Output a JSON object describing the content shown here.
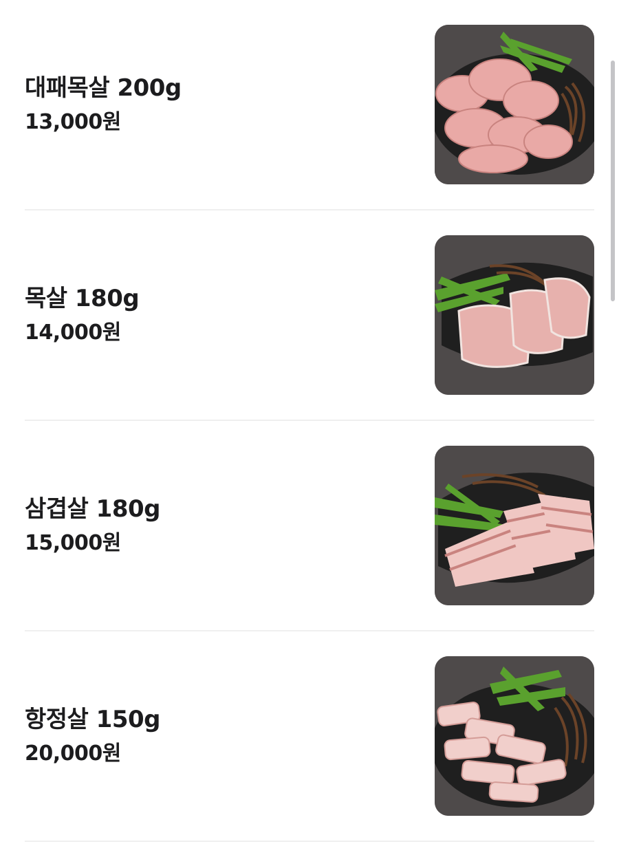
{
  "menu": {
    "items": [
      {
        "name": "대패목살 200g",
        "price": "13,000원",
        "image": "sliced-pork-neck-plate"
      },
      {
        "name": "목살 180g",
        "price": "14,000원",
        "image": "pork-neck-plate"
      },
      {
        "name": "삼겹살 180g",
        "price": "15,000원",
        "image": "pork-belly-plate"
      },
      {
        "name": "항정살 150g",
        "price": "20,000원",
        "image": "pork-jowl-plate"
      }
    ]
  },
  "colors": {
    "background": "#ffffff",
    "text": "#1c1c1e",
    "divider": "#efefef",
    "photo_backdrop": "#4e4a4a",
    "plate": "#1f1f1f",
    "meat": "#e9a9a6",
    "greens": "#5aa12e",
    "fernbrake": "#6b4328"
  }
}
